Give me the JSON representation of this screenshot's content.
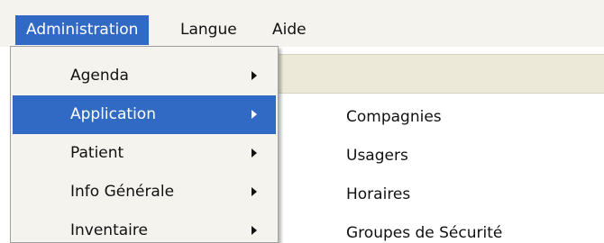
{
  "menubar": {
    "items": [
      {
        "label": "Administration",
        "active": true
      },
      {
        "label": "Langue",
        "active": false
      },
      {
        "label": "Aide",
        "active": false
      }
    ]
  },
  "admin_menu": {
    "items": [
      {
        "label": "Agenda",
        "has_submenu": true
      },
      {
        "label": "Application",
        "has_submenu": true,
        "highlighted": true
      },
      {
        "label": "Patient",
        "has_submenu": true
      },
      {
        "label": "Info Générale",
        "has_submenu": true
      },
      {
        "label": "Inventaire",
        "has_submenu": true
      }
    ]
  },
  "application_submenu": {
    "items": [
      {
        "label": "Compagnies"
      },
      {
        "label": "Usagers"
      },
      {
        "label": "Horaires"
      },
      {
        "label": "Groupes de Sécurité"
      }
    ]
  },
  "colors": {
    "highlight": "#316ac5",
    "menu_background": "#f4f3ee",
    "window_strip": "#ece9d8"
  },
  "icons": {
    "submenu_arrow": "chevron-right-icon"
  }
}
